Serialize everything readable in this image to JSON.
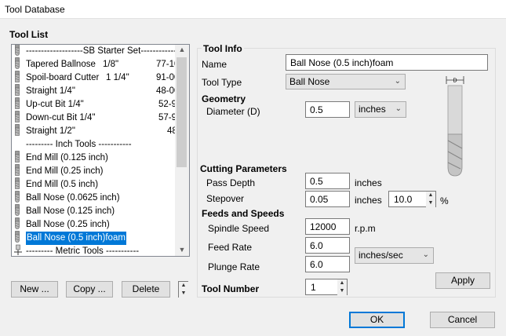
{
  "window": {
    "title": "Tool Database"
  },
  "tool_list": {
    "heading": "Tool List",
    "items": [
      {
        "name": "-------------------SB Starter Set------------",
        "diam": "",
        "part": "",
        "icon": "ballnose-bit-icon",
        "selected": false
      },
      {
        "name": "Tapered Ballnose",
        "diam": "1/8\"",
        "part": "77-10",
        "icon": "ballnose-bit-icon",
        "selected": false
      },
      {
        "name": "Spoil-board Cutter",
        "diam": "1 1/4\"",
        "part": "91-00",
        "icon": "endmill-bit-icon",
        "selected": false
      },
      {
        "name": "Straight 1/4\"",
        "diam": "",
        "part": "48-00",
        "icon": "endmill-bit-icon",
        "selected": false
      },
      {
        "name": "Up-cut Bit 1/4\"",
        "diam": "",
        "part": "52-9",
        "icon": "endmill-bit-icon",
        "selected": false
      },
      {
        "name": "Down-cut Bit 1/4\"",
        "diam": "",
        "part": "57-9",
        "icon": "endmill-bit-icon",
        "selected": false
      },
      {
        "name": "Straight 1/2\"",
        "diam": "",
        "part": "48",
        "icon": "endmill-bit-icon",
        "selected": false
      },
      {
        "name": "--------- Inch Tools -----------",
        "diam": "",
        "part": "",
        "icon": "",
        "selected": false
      },
      {
        "name": "End Mill (0.125 inch)",
        "diam": "",
        "part": "",
        "icon": "endmill-bit-icon",
        "selected": false
      },
      {
        "name": "End Mill (0.25 inch)",
        "diam": "",
        "part": "",
        "icon": "endmill-bit-icon",
        "selected": false
      },
      {
        "name": "End Mill (0.5 inch)",
        "diam": "",
        "part": "",
        "icon": "endmill-bit-icon",
        "selected": false
      },
      {
        "name": "Ball Nose (0.0625 inch)",
        "diam": "",
        "part": "",
        "icon": "ballnose-bit-icon",
        "selected": false
      },
      {
        "name": "Ball Nose (0.125 inch)",
        "diam": "",
        "part": "",
        "icon": "ballnose-bit-icon",
        "selected": false
      },
      {
        "name": "Ball Nose (0.25 inch)",
        "diam": "",
        "part": "",
        "icon": "ballnose-bit-icon",
        "selected": false
      },
      {
        "name": "Ball Nose (0.5 inch)foam",
        "diam": "",
        "part": "",
        "icon": "ballnose-bit-icon",
        "selected": true
      },
      {
        "name": "--------- Metric Tools -----------",
        "diam": "",
        "part": "",
        "icon": "collapse-tree-icon",
        "selected": false
      }
    ],
    "buttons": {
      "new": "New ...",
      "copy": "Copy ...",
      "delete": "Delete"
    }
  },
  "tool_info": {
    "heading": "Tool Info",
    "name_label": "Name",
    "name_value": "Ball Nose (0.5 inch)foam",
    "type_label": "Tool Type",
    "type_value": "Ball Nose",
    "diagram_label": "D",
    "geometry": {
      "heading": "Geometry",
      "diameter_label": "Diameter (D)",
      "diameter_value": "0.5",
      "units_value": "inches"
    },
    "cutting": {
      "heading": "Cutting Parameters",
      "pass_depth_label": "Pass Depth",
      "pass_depth_value": "0.5",
      "pass_depth_unit": "inches",
      "stepover_label": "Stepover",
      "stepover_value": "0.05",
      "stepover_unit": "inches",
      "stepover_pct_value": "10.0",
      "pct_symbol": "%"
    },
    "feeds": {
      "heading": "Feeds and Speeds",
      "spindle_label": "Spindle Speed",
      "spindle_value": "12000",
      "spindle_unit": "r.p.m",
      "feed_label": "Feed Rate",
      "feed_value": "6.0",
      "rate_units_value": "inches/sec",
      "plunge_label": "Plunge Rate",
      "plunge_value": "6.0"
    },
    "tool_number_label": "Tool Number",
    "tool_number_value": "1",
    "apply": "Apply"
  },
  "dialog": {
    "ok": "OK",
    "cancel": "Cancel"
  }
}
